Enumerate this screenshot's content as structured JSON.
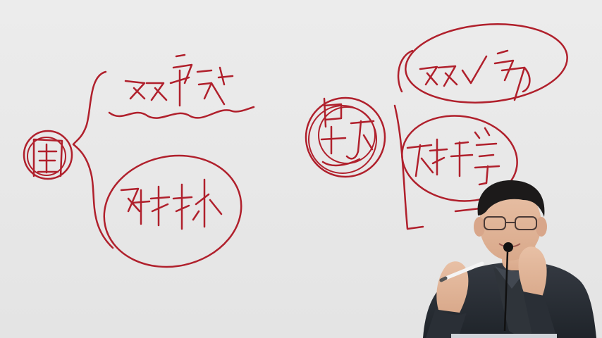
{
  "colors": {
    "ink": "#b0202c",
    "board": "#e6e6e6",
    "jacket": "#2a2f36",
    "shirt": "#3a3f46",
    "skin": "#e2b69a",
    "hair": "#1c1a1a"
  },
  "handwriting": {
    "left_root": "国",
    "left_top": "双语法",
    "left_bottom": "对打小",
    "right_root": "是万",
    "right_top": "双√多",
    "right_bottom": "不作等"
  }
}
